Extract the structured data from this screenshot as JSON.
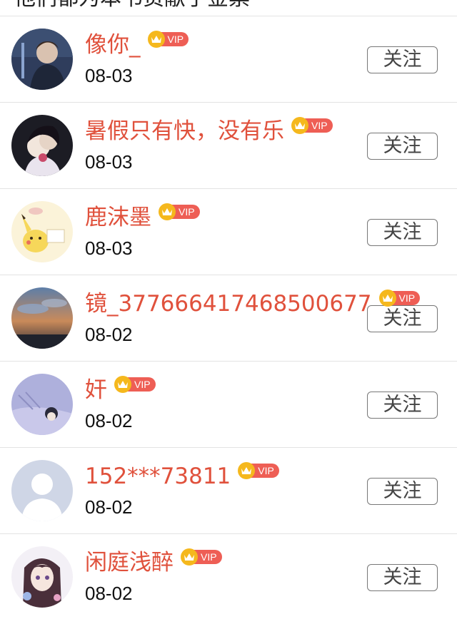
{
  "header": {
    "title": "他们都为本书贡献了金票"
  },
  "colors": {
    "name": "#e0513c",
    "vip_badge": "#ee5e55",
    "crown": "#f5b81d"
  },
  "users": [
    {
      "name": "像你_",
      "date": "08-03",
      "vip": "VIP",
      "follow": "关注",
      "avatar_icon": "boy-portrait-avatar"
    },
    {
      "name": "暑假只有快，没有乐",
      "date": "08-03",
      "vip": "VIP",
      "follow": "关注",
      "avatar_icon": "couple-portrait-avatar"
    },
    {
      "name": "鹿沫墨",
      "date": "08-03",
      "vip": "VIP",
      "follow": "关注",
      "avatar_icon": "pikachu-avatar"
    },
    {
      "name": "镜_377666417468500677",
      "date": "08-02",
      "vip": "VIP",
      "follow": "关注",
      "avatar_icon": "sunset-sky-avatar"
    },
    {
      "name": "奸",
      "date": "08-02",
      "vip": "VIP",
      "follow": "关注",
      "avatar_icon": "sleeping-figure-avatar"
    },
    {
      "name": "152***73811",
      "date": "08-02",
      "vip": "VIP",
      "follow": "关注",
      "avatar_icon": "default-user-avatar"
    },
    {
      "name": "闲庭浅醉",
      "date": "08-02",
      "vip": "VIP",
      "follow": "关注",
      "avatar_icon": "anime-girl-avatar"
    }
  ]
}
